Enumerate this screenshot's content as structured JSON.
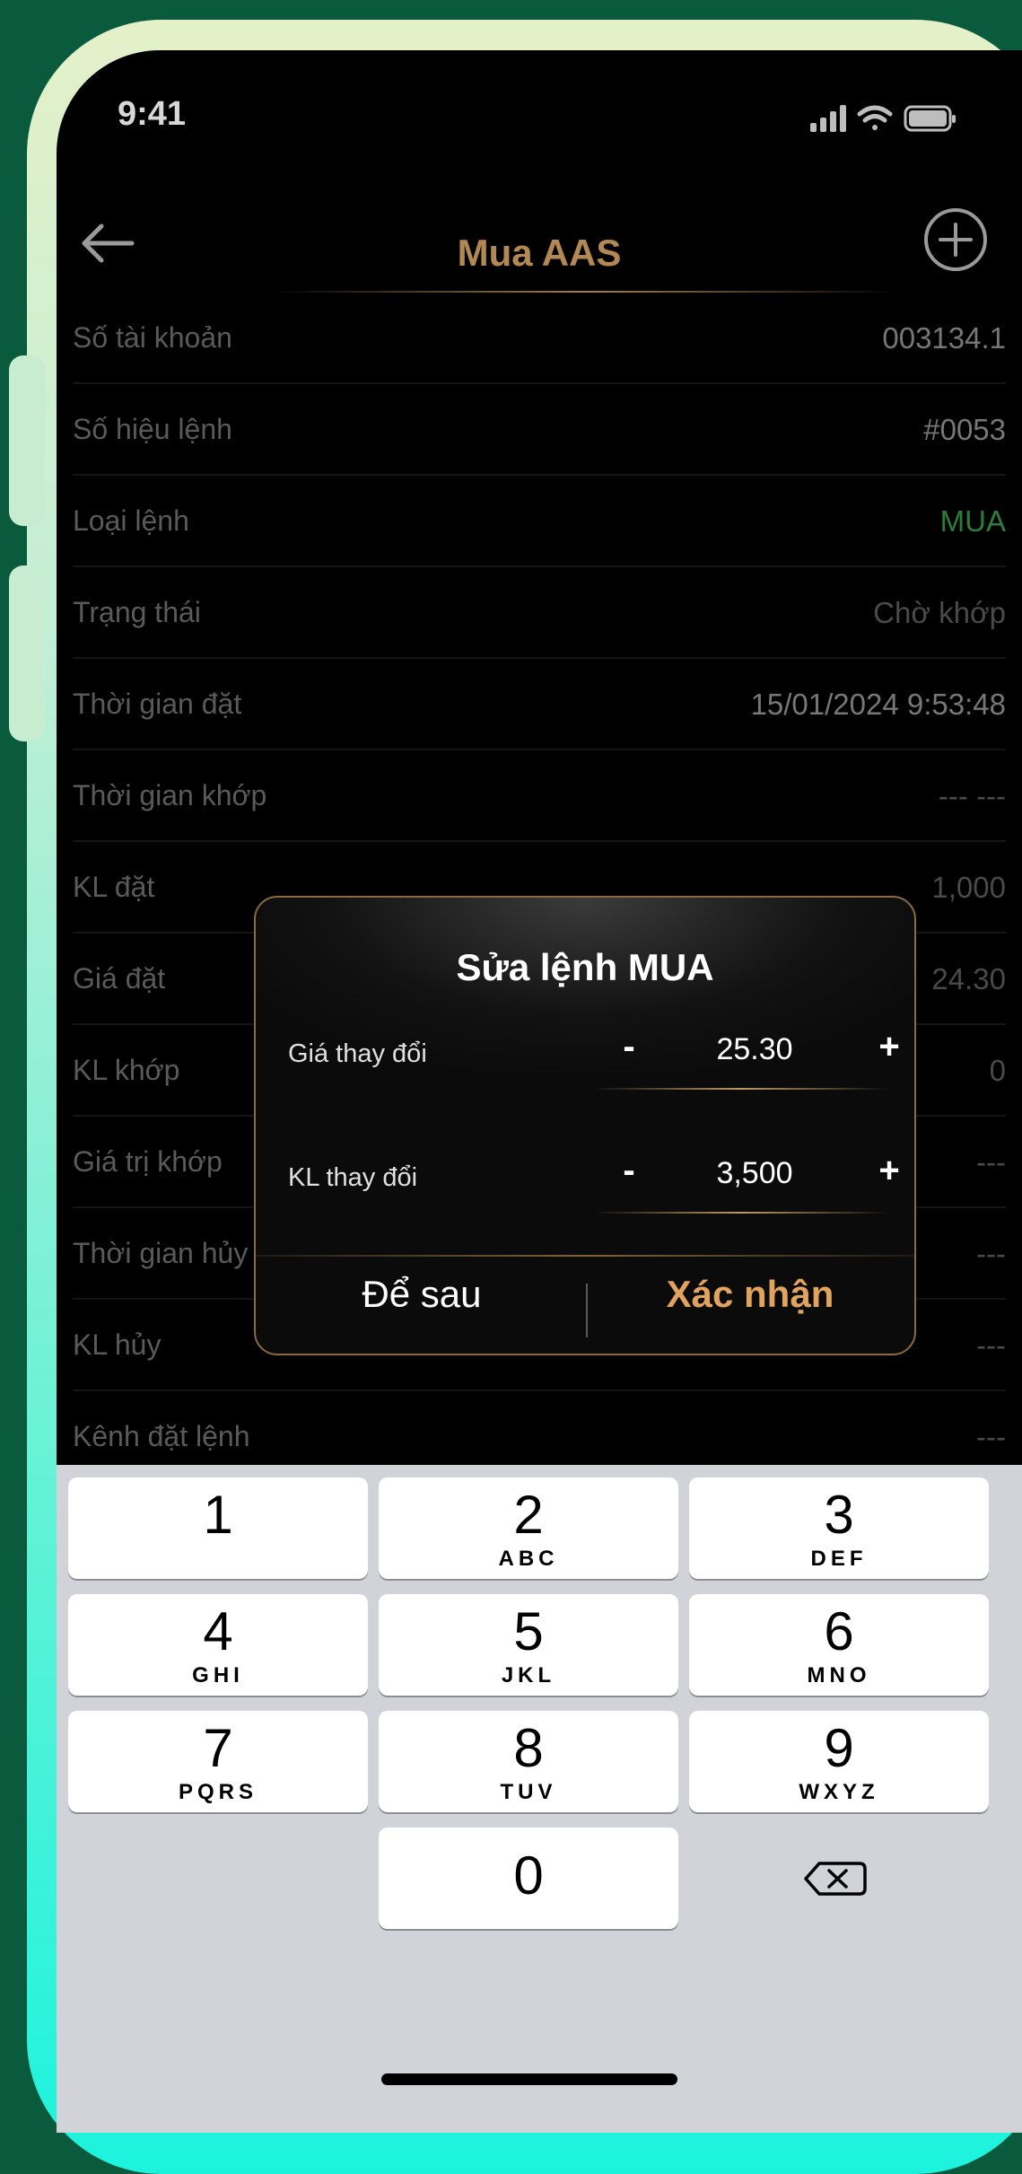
{
  "status_bar": {
    "time": "9:41",
    "icons": [
      "signal-icon",
      "wifi-icon",
      "battery-icon"
    ]
  },
  "nav": {
    "title": "Mua AAS",
    "back_icon": "arrow-left-icon",
    "add_icon": "plus-circle-icon"
  },
  "details": [
    {
      "label": "Số tài khoản",
      "value": "003134.1"
    },
    {
      "label": "Số hiệu lệnh",
      "value": "#0053"
    },
    {
      "label": "Loại lệnh",
      "value": "MUA",
      "color": "#2a7d3b"
    },
    {
      "label": "Trạng thái",
      "value": "Chờ khớp"
    },
    {
      "label": "Thời gian đặt",
      "value": "15/01/2024 9:53:48"
    },
    {
      "label": "Thời gian khớp",
      "value": "--- ---"
    },
    {
      "label": "KL đặt",
      "value": "1,000"
    },
    {
      "label": "Giá đặt",
      "value": "24.30"
    },
    {
      "label": "KL khớp",
      "value": "0"
    },
    {
      "label": "Giá trị khớp",
      "value": "---"
    },
    {
      "label": "Thời gian hủy",
      "value": "---"
    },
    {
      "label": "KL hủy",
      "value": "---"
    },
    {
      "label": "Kênh đặt lệnh",
      "value": "---"
    }
  ],
  "dialog": {
    "title": "Sửa lệnh MUA",
    "price": {
      "label": "Giá thay đổi",
      "value": "25.30",
      "minus": "-",
      "plus": "+"
    },
    "volume": {
      "label": "KL thay đổi",
      "value": "3,500",
      "minus": "-",
      "plus": "+"
    },
    "later_button": "Để sau",
    "confirm_button": "Xác nhận",
    "accent_color": "#e0a45e"
  },
  "keyboard": {
    "keys": [
      {
        "num": "1",
        "letters": ""
      },
      {
        "num": "2",
        "letters": "ABC"
      },
      {
        "num": "3",
        "letters": "DEF"
      },
      {
        "num": "4",
        "letters": "GHI"
      },
      {
        "num": "5",
        "letters": "JKL"
      },
      {
        "num": "6",
        "letters": "MNO"
      },
      {
        "num": "7",
        "letters": "PQRS"
      },
      {
        "num": "8",
        "letters": "TUV"
      },
      {
        "num": "9",
        "letters": "WXYZ"
      },
      {
        "num": "0",
        "letters": ""
      }
    ],
    "delete_icon": "backspace-icon"
  },
  "colors": {
    "background": "#0a5a3e",
    "title_gold": "#b28854",
    "keyboard_bg": "#d1d3d9"
  }
}
